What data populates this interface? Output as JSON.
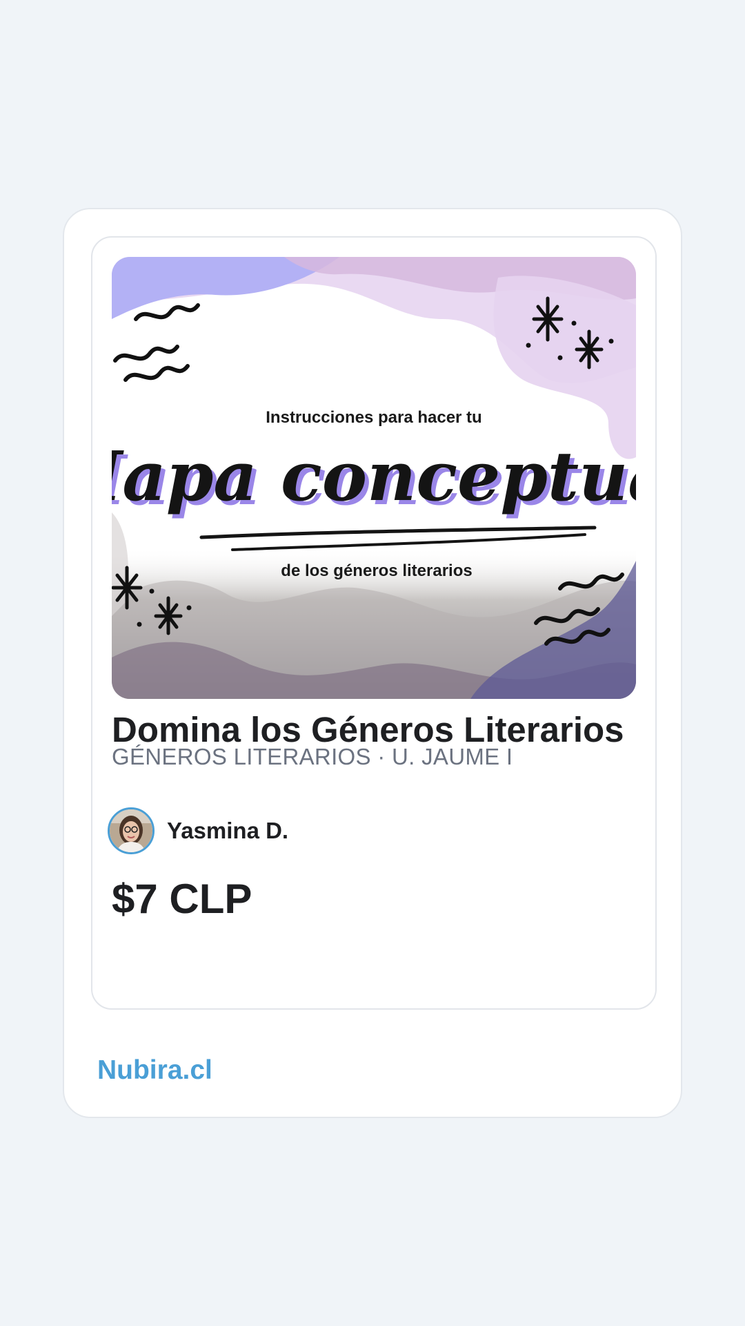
{
  "listing": {
    "thumbnail": {
      "top_text": "Instrucciones para hacer tu",
      "headline": "Mapa conceptual",
      "bottom_text": "de los géneros literarios"
    },
    "title": "Domina los Géneros Literarios",
    "subtitle": "GÉNEROS LITERARIOS · U. JAUME I",
    "author": {
      "name": "Yasmina D."
    },
    "price": "$7 CLP"
  },
  "footer": {
    "brand": "Nubira.cl"
  },
  "colors": {
    "page_background": "#f0f4f8",
    "brand_accent": "#4a9fd6",
    "text_primary": "#1e1f22",
    "text_secondary": "#6b7280"
  }
}
